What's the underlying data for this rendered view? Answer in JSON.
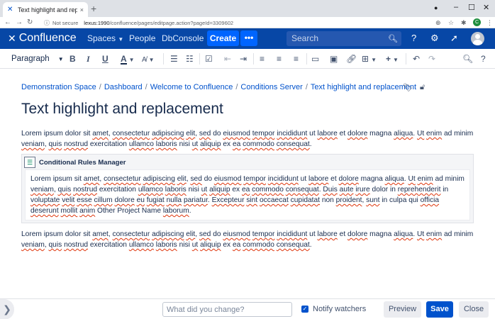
{
  "browser": {
    "tab_title": "Text highlight and replacement",
    "tab_close": "×",
    "new_tab": "+",
    "not_secure": "Not secure",
    "url_host": "lexus:1990",
    "url_path": "/confluence/pages/editpage.action?pageId=3309602",
    "profile_initial": "C"
  },
  "header": {
    "logo": "Confluence",
    "nav": [
      "Spaces",
      "People",
      "DbConsole"
    ],
    "create_label": "Create",
    "more_label": "•••",
    "search_placeholder": "Search"
  },
  "toolbar": {
    "paragraph_label": "Paragraph"
  },
  "breadcrumb": [
    "Demonstration Space",
    "Dashboard",
    "Welcome to Confluence",
    "Conditions Server",
    "Text highlight and replacement"
  ],
  "page": {
    "title": "Text highlight and replacement"
  },
  "macro": {
    "title": "Conditional Rules Manager"
  },
  "footer": {
    "change_placeholder": "What did you change?",
    "watch_label": "Notify watchers",
    "watch_checked": true,
    "preview_label": "Preview",
    "save_label": "Save",
    "close_label": "Close"
  },
  "colors": {
    "header_bg": "#0747a6",
    "primary": "#0052cc",
    "create_btn": "#0065ff",
    "spellcheck": "#de350b"
  }
}
